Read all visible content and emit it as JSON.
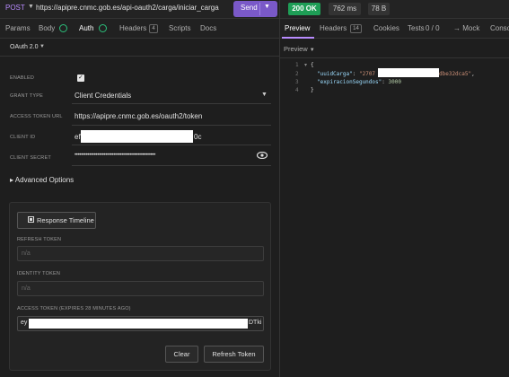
{
  "request": {
    "method": "POST",
    "url": "https://apipre.cnmc.gob.es/api-oauth2/carga/iniciar_carga",
    "send_label": "Send"
  },
  "response_meta": {
    "status": "200 OK",
    "time": "762 ms",
    "size": "78 B"
  },
  "left_tabs": {
    "params": "Params",
    "body": "Body",
    "auth": "Auth",
    "headers": "Headers",
    "headers_count": "4",
    "scripts": "Scripts",
    "docs": "Docs"
  },
  "auth": {
    "type": "OAuth 2.0",
    "enabled_label": "ENABLED",
    "enabled": true,
    "grant_type_label": "GRANT TYPE",
    "grant_type": "Client Credentials",
    "token_url_label": "ACCESS TOKEN URL",
    "token_url": "https://apipre.cnmc.gob.es/oauth2/token",
    "client_id_label": "CLIENT ID",
    "client_id_prefix": "ef",
    "client_id_suffix": "0c",
    "client_secret_label": "CLIENT SECRET",
    "client_secret": "••••••••••••••••••••••••••••••••••••••••••••••••••",
    "advanced_label": "Advanced Options"
  },
  "token_panel": {
    "timeline_button": "Response Timeline",
    "refresh_token_label": "REFRESH TOKEN",
    "refresh_token_placeholder": "n/a",
    "identity_token_label": "IDENTITY TOKEN",
    "identity_token_placeholder": "n/a",
    "access_token_label": "ACCESS TOKEN (EXPIRES 28 MINUTES AGO)",
    "access_token_prefix": "ey",
    "access_token_suffix": "DTki",
    "clear_button": "Clear",
    "refresh_button": "Refresh Token"
  },
  "right_tabs": {
    "preview": "Preview",
    "headers": "Headers",
    "headers_count": "14",
    "cookies": "Cookies",
    "tests": "Tests",
    "tests_count": "0 / 0",
    "mock": "→ Mock",
    "console": "Conso"
  },
  "preview_mode": "Preview",
  "response_body": {
    "line_numbers": [
      "1",
      "2",
      "3",
      "4"
    ],
    "open_brace": "{",
    "close_brace": "}",
    "key1": "\"uuidCarga\"",
    "val1_prefix": "\"2707",
    "val1_suffix": "dbe32dca5\"",
    "key2": "\"expiracionSegundos\"",
    "val2": "3000"
  },
  "colors": {
    "accent": "#7a59c8",
    "status_ok": "#1e9e56",
    "tab_indicator": "#2bbf7a"
  }
}
